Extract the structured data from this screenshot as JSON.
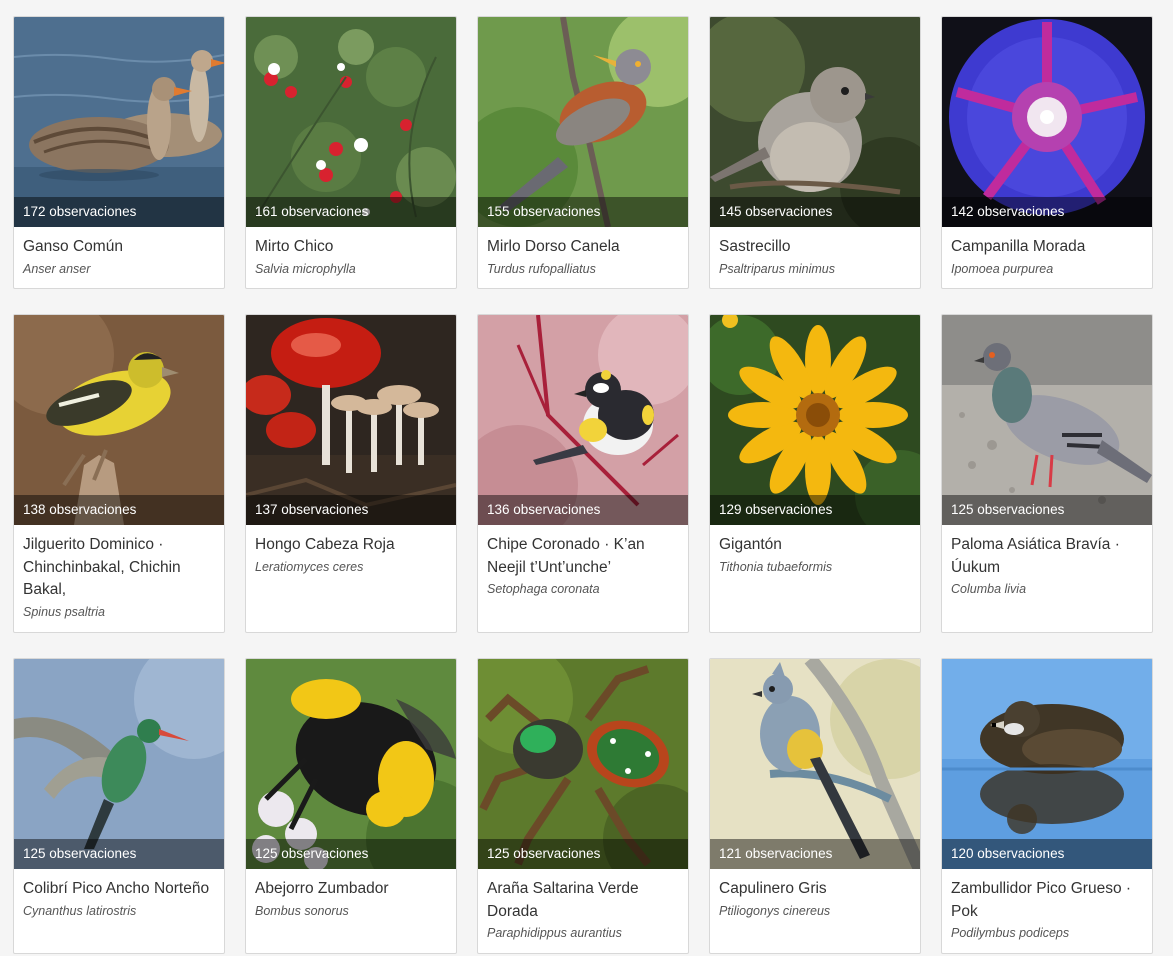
{
  "cards": [
    {
      "count": "172 observaciones",
      "common": "Ganso Común",
      "scientific": "Anser anser"
    },
    {
      "count": "161 observaciones",
      "common": "Mirto Chico",
      "scientific": "Salvia microphylla"
    },
    {
      "count": "155 observaciones",
      "common": "Mirlo Dorso Canela",
      "scientific": "Turdus rufopalliatus"
    },
    {
      "count": "145 observaciones",
      "common": "Sastrecillo",
      "scientific": "Psaltriparus minimus"
    },
    {
      "count": "142 observaciones",
      "common": "Campanilla Morada",
      "scientific": "Ipomoea purpurea"
    },
    {
      "count": "138 observaciones",
      "common": "Jilguerito Dominico · Chinchinbakal, Chichin Bakal,",
      "scientific": "Spinus psaltria"
    },
    {
      "count": "137 observaciones",
      "common": "Hongo Cabeza Roja",
      "scientific": "Leratiomyces ceres"
    },
    {
      "count": "136 observaciones",
      "common": "Chipe Coronado · K’an Neejil t’Unt’unche’",
      "scientific": "Setophaga coronata"
    },
    {
      "count": "129 observaciones",
      "common": "Gigantón",
      "scientific": "Tithonia tubaeformis"
    },
    {
      "count": "125 observaciones",
      "common": "Paloma Asiática Bravía · Úukum",
      "scientific": "Columba livia"
    },
    {
      "count": "125 observaciones",
      "common": "Colibrí Pico Ancho Norteño",
      "scientific": "Cynanthus latirostris"
    },
    {
      "count": "125 observaciones",
      "common": "Abejorro Zumbador",
      "scientific": "Bombus sonorus"
    },
    {
      "count": "125 observaciones",
      "common": "Araña Saltarina Verde Dorada",
      "scientific": "Paraphidippus aurantius"
    },
    {
      "count": "121 observaciones",
      "common": "Capulinero Gris",
      "scientific": "Ptiliogonys cinereus"
    },
    {
      "count": "120 observaciones",
      "common": "Zambullidor Pico Grueso · Pok",
      "scientific": "Podilymbus podiceps"
    }
  ]
}
